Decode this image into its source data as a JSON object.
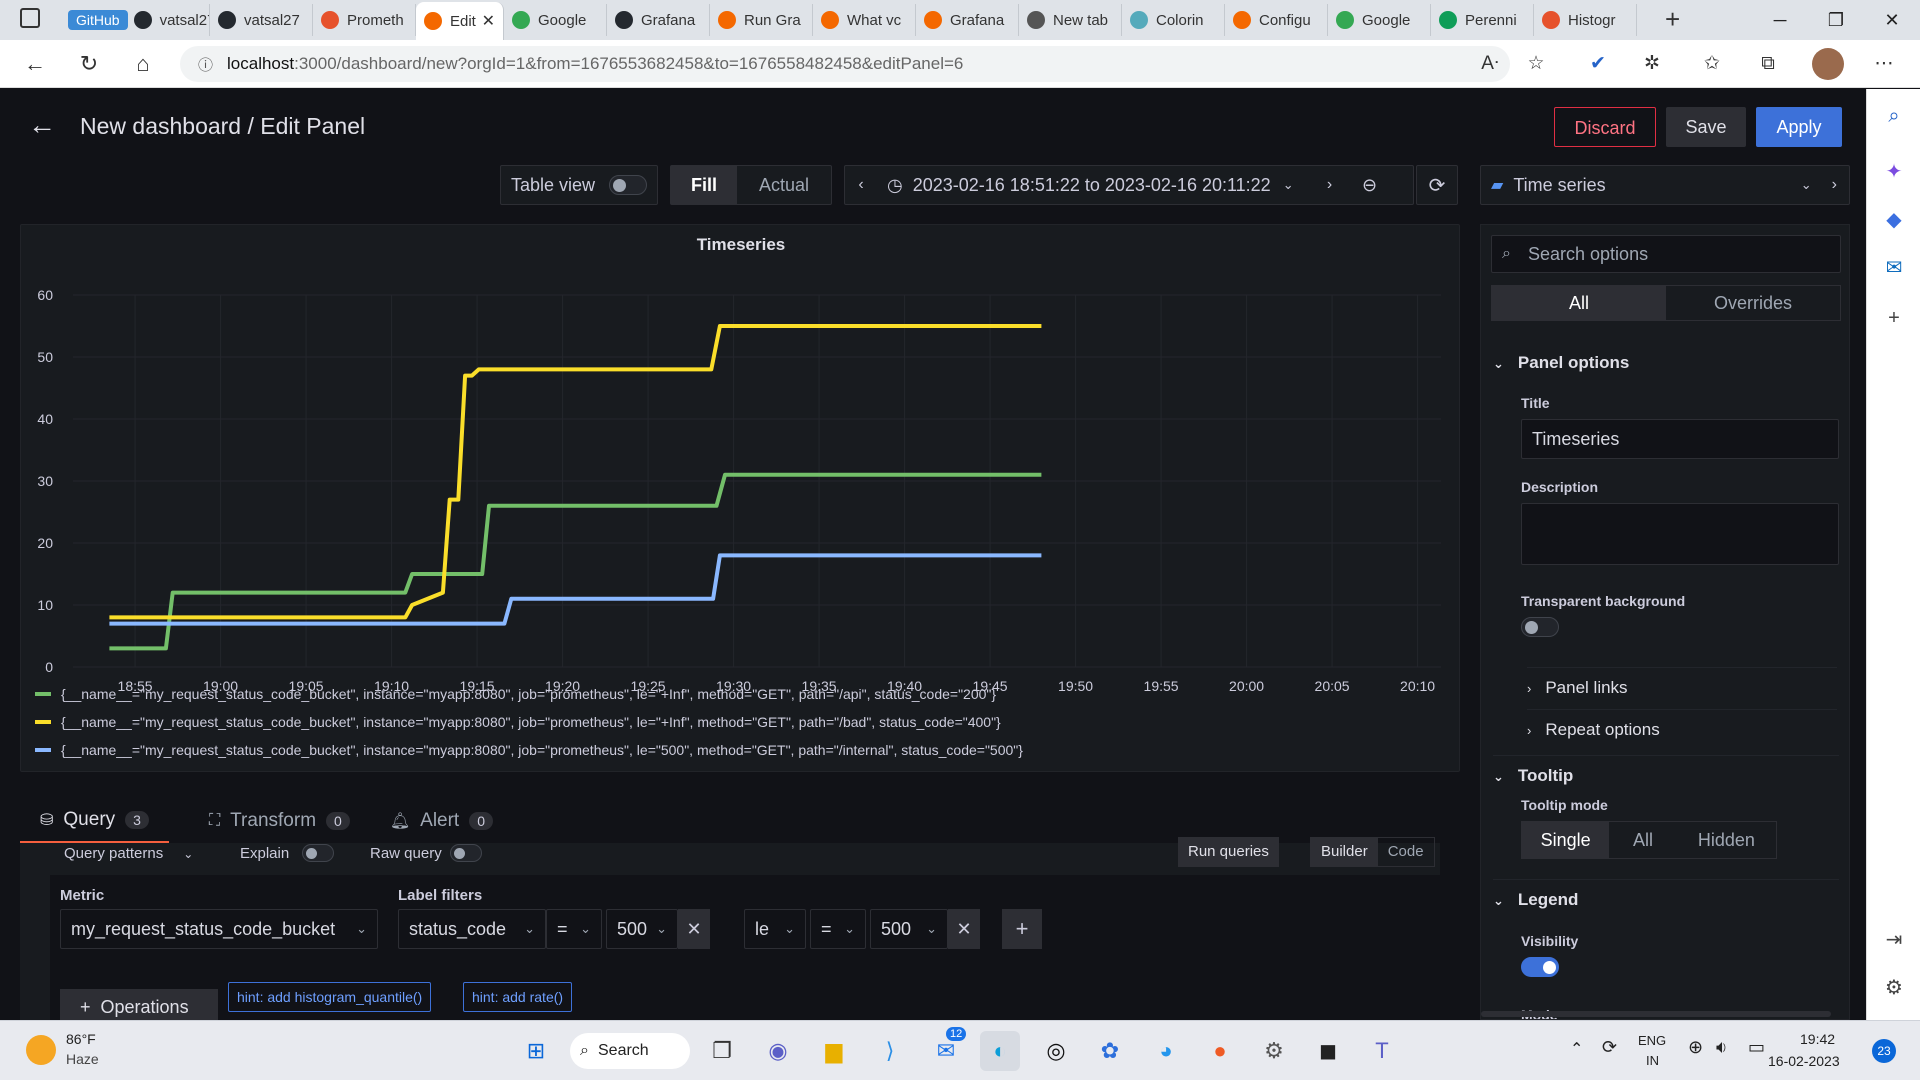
{
  "browser": {
    "tabs": [
      {
        "label": "vatsal27",
        "color": "#24292f",
        "pill": "GitHub"
      },
      {
        "label": "vatsal27",
        "color": "#24292f"
      },
      {
        "label": "Prometh",
        "color": "#e6522c"
      },
      {
        "label": "Edit",
        "color": "#f46800",
        "active": true
      },
      {
        "label": "Google",
        "color": "#34a853"
      },
      {
        "label": "Grafana",
        "color": "#24292f"
      },
      {
        "label": "Run Gra",
        "color": "#f46800"
      },
      {
        "label": "What vc",
        "color": "#f46800"
      },
      {
        "label": "Grafana",
        "color": "#f46800"
      },
      {
        "label": "New tab",
        "color": "#555"
      },
      {
        "label": "Colorin",
        "color": "#5ab"
      },
      {
        "label": "Configu",
        "color": "#f46800"
      },
      {
        "label": "Google",
        "color": "#34a853"
      },
      {
        "label": "Perenni",
        "color": "#0f9d58"
      },
      {
        "label": "Histogr",
        "color": "#e6522c"
      }
    ],
    "url_host": "localhost",
    "url_rest": ":3000/dashboard/new?orgId=1&from=1676553682458&to=1676558482458&editPanel=6"
  },
  "header": {
    "title": "New dashboard / Edit Panel",
    "discard": "Discard",
    "save": "Save",
    "apply": "Apply"
  },
  "toolbar": {
    "table_view": "Table view",
    "fill": "Fill",
    "actual": "Actual",
    "time_range": "2023-02-16 18:51:22 to 2023-02-16 20:11:22",
    "visualization": "Time series"
  },
  "options": {
    "search_placeholder": "Search options",
    "tab_all": "All",
    "tab_overrides": "Overrides",
    "panel_options": "Panel options",
    "title_label": "Title",
    "title_value": "Timeseries",
    "description_label": "Description",
    "transparent_label": "Transparent background",
    "panel_links": "Panel links",
    "repeat_options": "Repeat options",
    "tooltip": "Tooltip",
    "tooltip_mode_label": "Tooltip mode",
    "tooltip_modes": [
      "Single",
      "All",
      "Hidden"
    ],
    "legend": "Legend",
    "visibility_label": "Visibility",
    "mode_label": "Mode"
  },
  "query": {
    "tab_query": "Query",
    "query_count": "3",
    "tab_transform": "Transform",
    "transform_count": "0",
    "tab_alert": "Alert",
    "alert_count": "0",
    "query_patterns": "Query patterns",
    "explain": "Explain",
    "raw_query": "Raw query",
    "run_queries": "Run queries",
    "builder": "Builder",
    "code": "Code",
    "metric_label": "Metric",
    "metric_value": "my_request_status_code_bucket",
    "label_filters": "Label filters",
    "filter1_label": "status_code",
    "filter1_op": "=",
    "filter1_value": "500",
    "filter2_label": "le",
    "filter2_op": "=",
    "filter2_value": "500",
    "operations": "Operations",
    "hint1": "hint: add histogram_quantile()",
    "hint2": "hint: add rate()"
  },
  "chart_data": {
    "type": "line",
    "title": "Timeseries",
    "y_ticks": [
      0,
      10,
      20,
      30,
      40,
      50,
      60
    ],
    "ylim": [
      0,
      60
    ],
    "x_ticks": [
      "18:55",
      "19:00",
      "19:05",
      "19:10",
      "19:15",
      "19:20",
      "19:25",
      "19:30",
      "19:35",
      "19:40",
      "19:45",
      "19:50",
      "19:55",
      "20:00",
      "20:05",
      "20:10"
    ],
    "x_tick_minutes": [
      55,
      60,
      65,
      70,
      75,
      80,
      85,
      90,
      95,
      100,
      105,
      110,
      115,
      120,
      125,
      130
    ],
    "xlim_minutes": [
      51.37,
      131.37
    ],
    "x_unit": "minutes after 18:00",
    "series": [
      {
        "name": "{__name__=\"my_request_status_code_bucket\", instance=\"myapp:8080\", job=\"prometheus\", le=\"+Inf\", method=\"GET\", path=\"/api\", status_code=\"200\"}",
        "color": "#73bf69",
        "points": [
          [
            53.5,
            3
          ],
          [
            56.8,
            3
          ],
          [
            57.2,
            12
          ],
          [
            70.8,
            12
          ],
          [
            71.2,
            15
          ],
          [
            75.3,
            15
          ],
          [
            75.7,
            26
          ],
          [
            89.0,
            26
          ],
          [
            89.5,
            31
          ],
          [
            108.0,
            31
          ]
        ]
      },
      {
        "name": "{__name__=\"my_request_status_code_bucket\", instance=\"myapp:8080\", job=\"prometheus\", le=\"+Inf\", method=\"GET\", path=\"/bad\", status_code=\"400\"}",
        "color": "#fade2a",
        "points": [
          [
            53.5,
            8
          ],
          [
            70.8,
            8
          ],
          [
            71.2,
            10
          ],
          [
            73.0,
            12
          ],
          [
            73.4,
            27
          ],
          [
            73.9,
            27
          ],
          [
            74.3,
            47
          ],
          [
            74.7,
            47
          ],
          [
            75.1,
            48
          ],
          [
            88.7,
            48
          ],
          [
            89.2,
            55
          ],
          [
            108.0,
            55
          ]
        ]
      },
      {
        "name": "{__name__=\"my_request_status_code_bucket\", instance=\"myapp:8080\", job=\"prometheus\", le=\"500\", method=\"GET\", path=\"/internal\", status_code=\"500\"}",
        "color": "#8ab8ff",
        "points": [
          [
            53.5,
            7
          ],
          [
            76.6,
            7
          ],
          [
            77.0,
            11
          ],
          [
            88.8,
            11
          ],
          [
            89.2,
            18
          ],
          [
            108.0,
            18
          ]
        ]
      }
    ]
  },
  "taskbar": {
    "weather_temp": "86°F",
    "weather_desc": "Haze",
    "search": "Search",
    "lang1": "ENG",
    "lang2": "IN",
    "time": "19:42",
    "date": "16-02-2023",
    "notif": "23",
    "badge": "12"
  }
}
